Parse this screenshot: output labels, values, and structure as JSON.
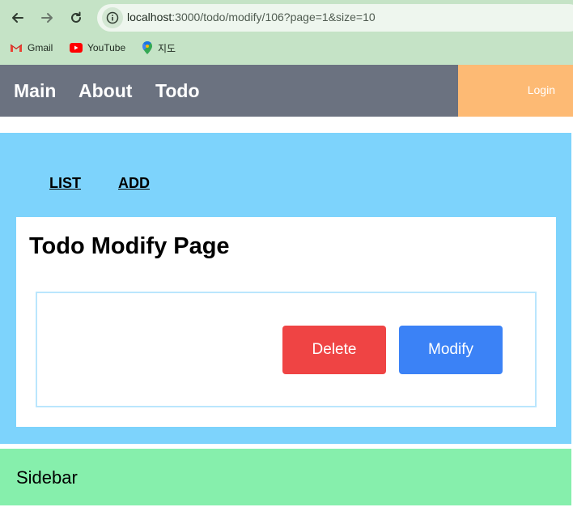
{
  "browser": {
    "url_host": "localhost",
    "url_path": ":3000/todo/modify/106?page=1&size=10",
    "bookmarks": [
      {
        "label": "Gmail",
        "icon": "gmail-icon"
      },
      {
        "label": "YouTube",
        "icon": "youtube-icon"
      },
      {
        "label": "지도",
        "icon": "maps-icon"
      }
    ]
  },
  "header": {
    "nav": [
      {
        "label": "Main"
      },
      {
        "label": "About"
      },
      {
        "label": "Todo"
      }
    ],
    "login_label": "Login"
  },
  "main": {
    "links": [
      {
        "label": "LIST"
      },
      {
        "label": "ADD"
      }
    ],
    "title": "Todo Modify Page",
    "delete_label": "Delete",
    "modify_label": "Modify"
  },
  "sidebar": {
    "label": "Sidebar"
  },
  "colors": {
    "header_bg": "#6b7280",
    "login_bg": "#fdba74",
    "main_bg": "#7dd3fc",
    "delete_bg": "#ef4444",
    "modify_bg": "#3b82f6",
    "sidebar_bg": "#86efac"
  }
}
